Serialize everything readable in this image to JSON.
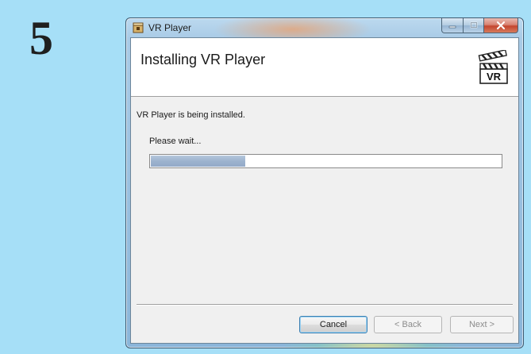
{
  "step": {
    "number": "5"
  },
  "window": {
    "title": "VR Player",
    "controls": {
      "minimize": "minimize-icon",
      "maximize": "maximize-icon",
      "close": "close-icon"
    }
  },
  "header": {
    "title": "Installing VR Player",
    "logo_text": "VR"
  },
  "body": {
    "status": "VR Player is being installed.",
    "wait": "Please wait...",
    "progress_fraction": 0.27
  },
  "buttons": {
    "cancel": "Cancel",
    "back": "< Back",
    "next": "Next >"
  },
  "colors": {
    "background": "#a6dff7",
    "progress_fill": "#9db3ce",
    "close_button": "#c4452f"
  }
}
